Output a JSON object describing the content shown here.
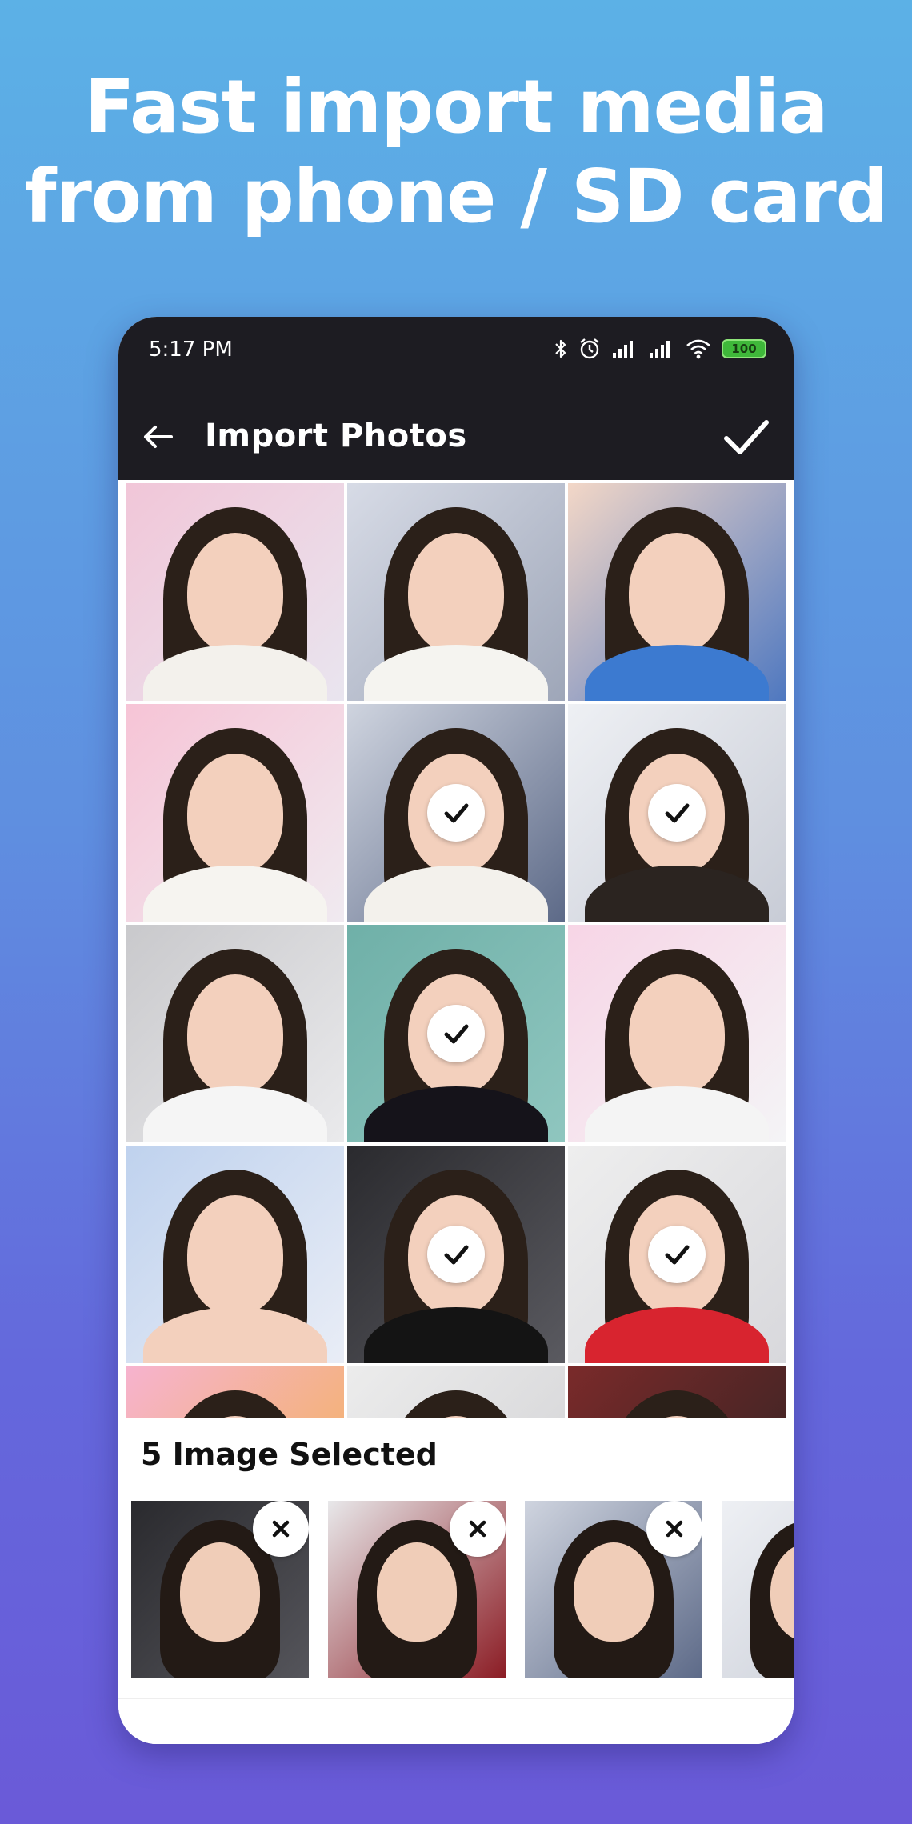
{
  "headline": {
    "line1": "Fast import media",
    "line2": "from phone / SD card"
  },
  "status_bar": {
    "time": "5:17 PM",
    "battery": "100",
    "icons": [
      "bluetooth-icon",
      "alarm-icon",
      "signal-icon",
      "signal-icon",
      "wifi-icon",
      "battery-icon"
    ]
  },
  "app_bar": {
    "title": "Import Photos",
    "back_icon": "arrow-left-icon",
    "confirm_icon": "check-icon"
  },
  "grid": {
    "photos": [
      {
        "selected": false
      },
      {
        "selected": false
      },
      {
        "selected": false
      },
      {
        "selected": false
      },
      {
        "selected": true
      },
      {
        "selected": true
      },
      {
        "selected": false
      },
      {
        "selected": true
      },
      {
        "selected": false
      },
      {
        "selected": false
      },
      {
        "selected": true
      },
      {
        "selected": true
      },
      {
        "selected": false
      },
      {
        "selected": false
      },
      {
        "selected": false
      }
    ]
  },
  "selected_panel": {
    "title": "5 Image Selected",
    "remove_icon": "close-icon",
    "thumb_count_visible": 4
  },
  "colors": {
    "app_bar_bg": "#1d1c22",
    "badge_bg": "#ffffff",
    "battery_green": "#3fb83a"
  }
}
